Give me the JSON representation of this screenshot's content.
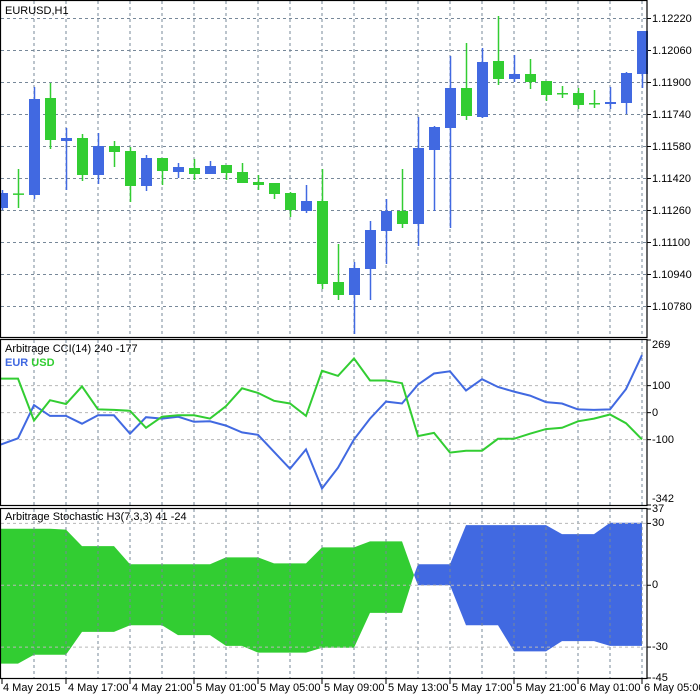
{
  "main": {
    "title": "EURUSD,H1",
    "price_axis": [
      "1.12220",
      "1.12060",
      "1.11900",
      "1.11740",
      "1.11580",
      "1.11420",
      "1.11260",
      "1.11100",
      "1.10940",
      "1.10780"
    ],
    "colors": {
      "bull": "#4169E1",
      "bear": "#32CD32",
      "grid": "#778899"
    },
    "candles": {
      "open": [
        1.1127,
        1.11343,
        1.11335,
        1.1182,
        1.11605,
        1.1162,
        1.11435,
        1.1158,
        1.11555,
        1.1138,
        1.1152,
        1.1145,
        1.1147,
        1.1144,
        1.11485,
        1.1145,
        1.114,
        1.11395,
        1.11345,
        1.11255,
        1.11305,
        1.109,
        1.10835,
        1.10965,
        1.11155,
        1.11255,
        1.1119,
        1.1156,
        1.1167,
        1.1187,
        1.11725,
        1.12005,
        1.11915,
        1.1194,
        1.11905,
        1.11845,
        1.11845,
        1.11795,
        1.1179,
        1.11795,
        1.1194
      ],
      "high": [
        1.1136,
        1.11465,
        1.11875,
        1.11895,
        1.1167,
        1.1164,
        1.11645,
        1.11605,
        1.11575,
        1.11535,
        1.1152,
        1.11495,
        1.11515,
        1.11505,
        1.11485,
        1.11495,
        1.11435,
        1.11395,
        1.1135,
        1.11385,
        1.11465,
        1.1109,
        1.11,
        1.11205,
        1.11315,
        1.11465,
        1.11725,
        1.1168,
        1.1203,
        1.12095,
        1.1207,
        1.1223,
        1.12035,
        1.12015,
        1.11905,
        1.1188,
        1.1187,
        1.1186,
        1.11875,
        1.1195,
        1.12155
      ],
      "low": [
        1.1126,
        1.1127,
        1.11315,
        1.11565,
        1.1136,
        1.11405,
        1.1139,
        1.11475,
        1.113,
        1.11355,
        1.11385,
        1.1142,
        1.1141,
        1.1144,
        1.1141,
        1.11395,
        1.1136,
        1.11315,
        1.11225,
        1.11245,
        1.10865,
        1.1081,
        1.1064,
        1.1081,
        1.1099,
        1.1117,
        1.1108,
        1.11255,
        1.1117,
        1.1171,
        1.1172,
        1.11885,
        1.119,
        1.11865,
        1.11805,
        1.1182,
        1.11765,
        1.1177,
        1.11765,
        1.1174,
        1.1187
      ],
      "close": [
        1.11345,
        1.1134,
        1.11815,
        1.1161,
        1.1162,
        1.11435,
        1.1158,
        1.1155,
        1.1138,
        1.1152,
        1.11455,
        1.11475,
        1.1144,
        1.1148,
        1.11445,
        1.11395,
        1.11385,
        1.1134,
        1.1126,
        1.11305,
        1.1089,
        1.10835,
        1.1097,
        1.1116,
        1.11255,
        1.1119,
        1.1157,
        1.11675,
        1.1187,
        1.1173,
        1.12,
        1.11915,
        1.1194,
        1.119,
        1.11835,
        1.11843,
        1.11785,
        1.11793,
        1.118,
        1.11945,
        1.12155
      ]
    }
  },
  "cci": {
    "title": "Arbitrage CCI(14) 240 -177",
    "legend": [
      {
        "label": "EUR",
        "color": "#4169E1"
      },
      {
        "label": "USD",
        "color": "#32CD32"
      }
    ],
    "axis": [
      "269",
      "100",
      "0",
      "-100",
      "-342"
    ],
    "levels": [
      100,
      0,
      -100
    ],
    "range": [
      -342,
      269
    ],
    "series": {
      "EUR": [
        -119,
        -95,
        28,
        -12,
        -12,
        -41,
        -10,
        -10,
        -78,
        -17,
        -22,
        -15,
        -34,
        -32,
        -48,
        -73,
        -82,
        -145,
        -208,
        -136,
        -281,
        -204,
        -99,
        -22,
        41,
        34,
        104,
        145,
        153,
        82,
        124,
        95,
        78,
        63,
        39,
        34,
        12,
        10,
        12,
        87,
        213
      ],
      "USD": [
        126,
        126,
        -29,
        46,
        32,
        97,
        12,
        10,
        7,
        -56,
        -15,
        -10,
        -10,
        -22,
        24,
        90,
        73,
        44,
        34,
        -12,
        155,
        136,
        201,
        119,
        119,
        109,
        -87,
        -75,
        -148,
        -141,
        -141,
        -97,
        -97,
        -78,
        -61,
        -56,
        -32,
        -22,
        -7,
        -39,
        -99
      ]
    }
  },
  "stoch": {
    "title": "Arbitrage Stochastic H3(7,3,3) 41 -24",
    "axis": [
      "37",
      "30",
      "0",
      "-30",
      "-45"
    ],
    "levels": [
      30,
      0,
      -30
    ],
    "range": [
      -45,
      37
    ],
    "upper": [
      27.4,
      27.4,
      27.4,
      27.4,
      27,
      19,
      19,
      19,
      10.2,
      10.2,
      10.2,
      10.2,
      10.2,
      10.2,
      13.5,
      13.5,
      13.5,
      10.6,
      10.6,
      10.6,
      18.4,
      18.4,
      18.4,
      21.3,
      21.3,
      21.3,
      10.2,
      10.2,
      10.2,
      29.2,
      29.2,
      29.2,
      29.2,
      29.2,
      29.2,
      24.8,
      24.8,
      24.8,
      30.3,
      30.3,
      30.3
    ],
    "lower": [
      -38,
      -38,
      -33.7,
      -33.7,
      -33.7,
      -22.6,
      -22.6,
      -22.6,
      -19.4,
      -19.4,
      -19.4,
      -24.2,
      -24.2,
      -24.2,
      -29.4,
      -29.4,
      -32.7,
      -32.7,
      -32.7,
      -32.7,
      -30.3,
      -30.3,
      -30.3,
      -13.4,
      -13.4,
      -13.4,
      0,
      0,
      0,
      -19.4,
      -19.4,
      -19.4,
      -32.1,
      -32.1,
      -32.1,
      -27.1,
      -27.1,
      -27.1,
      -29.4,
      -29.4,
      -29.4
    ],
    "segments": [
      {
        "from": 0,
        "to": 25,
        "color": "#32CD32"
      },
      {
        "from": 26,
        "to": 40,
        "color": "#4169E1"
      }
    ]
  },
  "time_axis": [
    "4 May 2015",
    "4 May 17:00",
    "4 May 21:00",
    "5 May 01:00",
    "5 May 05:00",
    "5 May 09:00",
    "5 May 13:00",
    "5 May 17:00",
    "5 May 21:00",
    "6 May 01:00",
    "6 May 05:00"
  ]
}
